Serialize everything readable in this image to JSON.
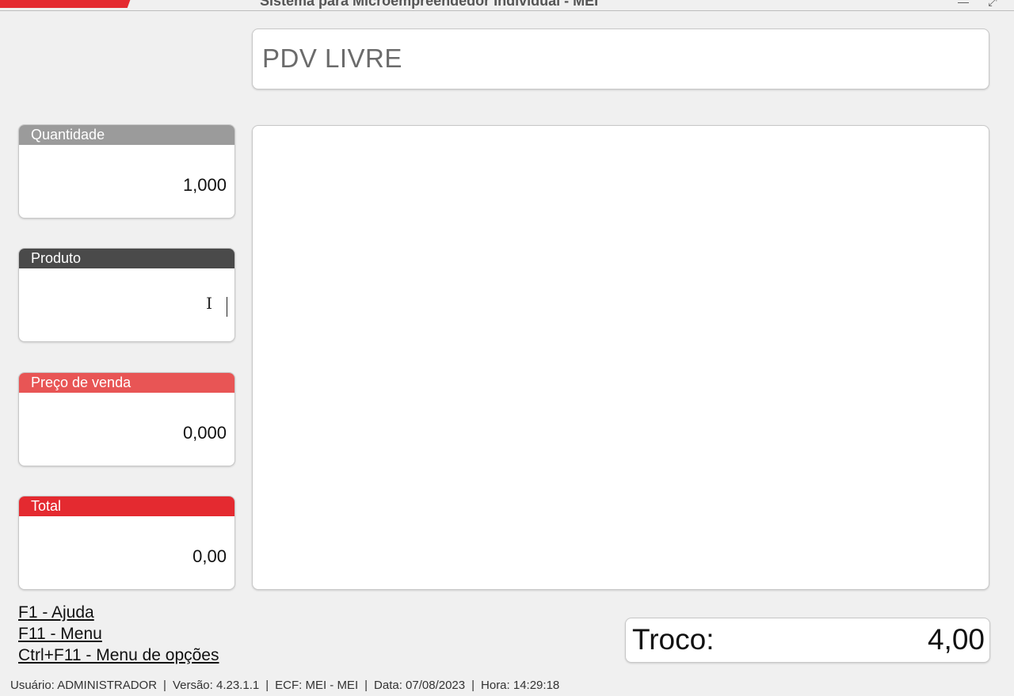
{
  "window": {
    "title": "Sistema para Microempreendedor Individual - MEI",
    "minimize_glyph": "—",
    "maximize_glyph": "⤢"
  },
  "header": {
    "text": "PDV LIVRE"
  },
  "fields": {
    "quantidade": {
      "label": "Quantidade",
      "value": "1,000"
    },
    "produto": {
      "label": "Produto",
      "value": ""
    },
    "preco": {
      "label": "Preço de venda",
      "value": "0,000"
    },
    "total": {
      "label": "Total",
      "value": "0,00"
    }
  },
  "shortcuts": {
    "help": "F1 - Ajuda",
    "menu": "F11 - Menu",
    "options": "Ctrl+F11 - Menu de opções"
  },
  "troco": {
    "label": "Troco:",
    "value": "4,00"
  },
  "status": {
    "usuario": "Usuário: ADMINISTRADOR",
    "versao": "Versão: 4.23.1.1",
    "ecf": "ECF: MEI - MEI",
    "data": "Data: 07/08/2023",
    "hora": "Hora: 14:29:18"
  },
  "colors": {
    "accent_red": "#e42a30",
    "label_light_red": "#e85555",
    "label_grey": "#9b9b9b",
    "label_dark": "#4a4a4a",
    "background": "#f0f0f0"
  },
  "icons": {
    "text_cursor": "I-beam"
  }
}
